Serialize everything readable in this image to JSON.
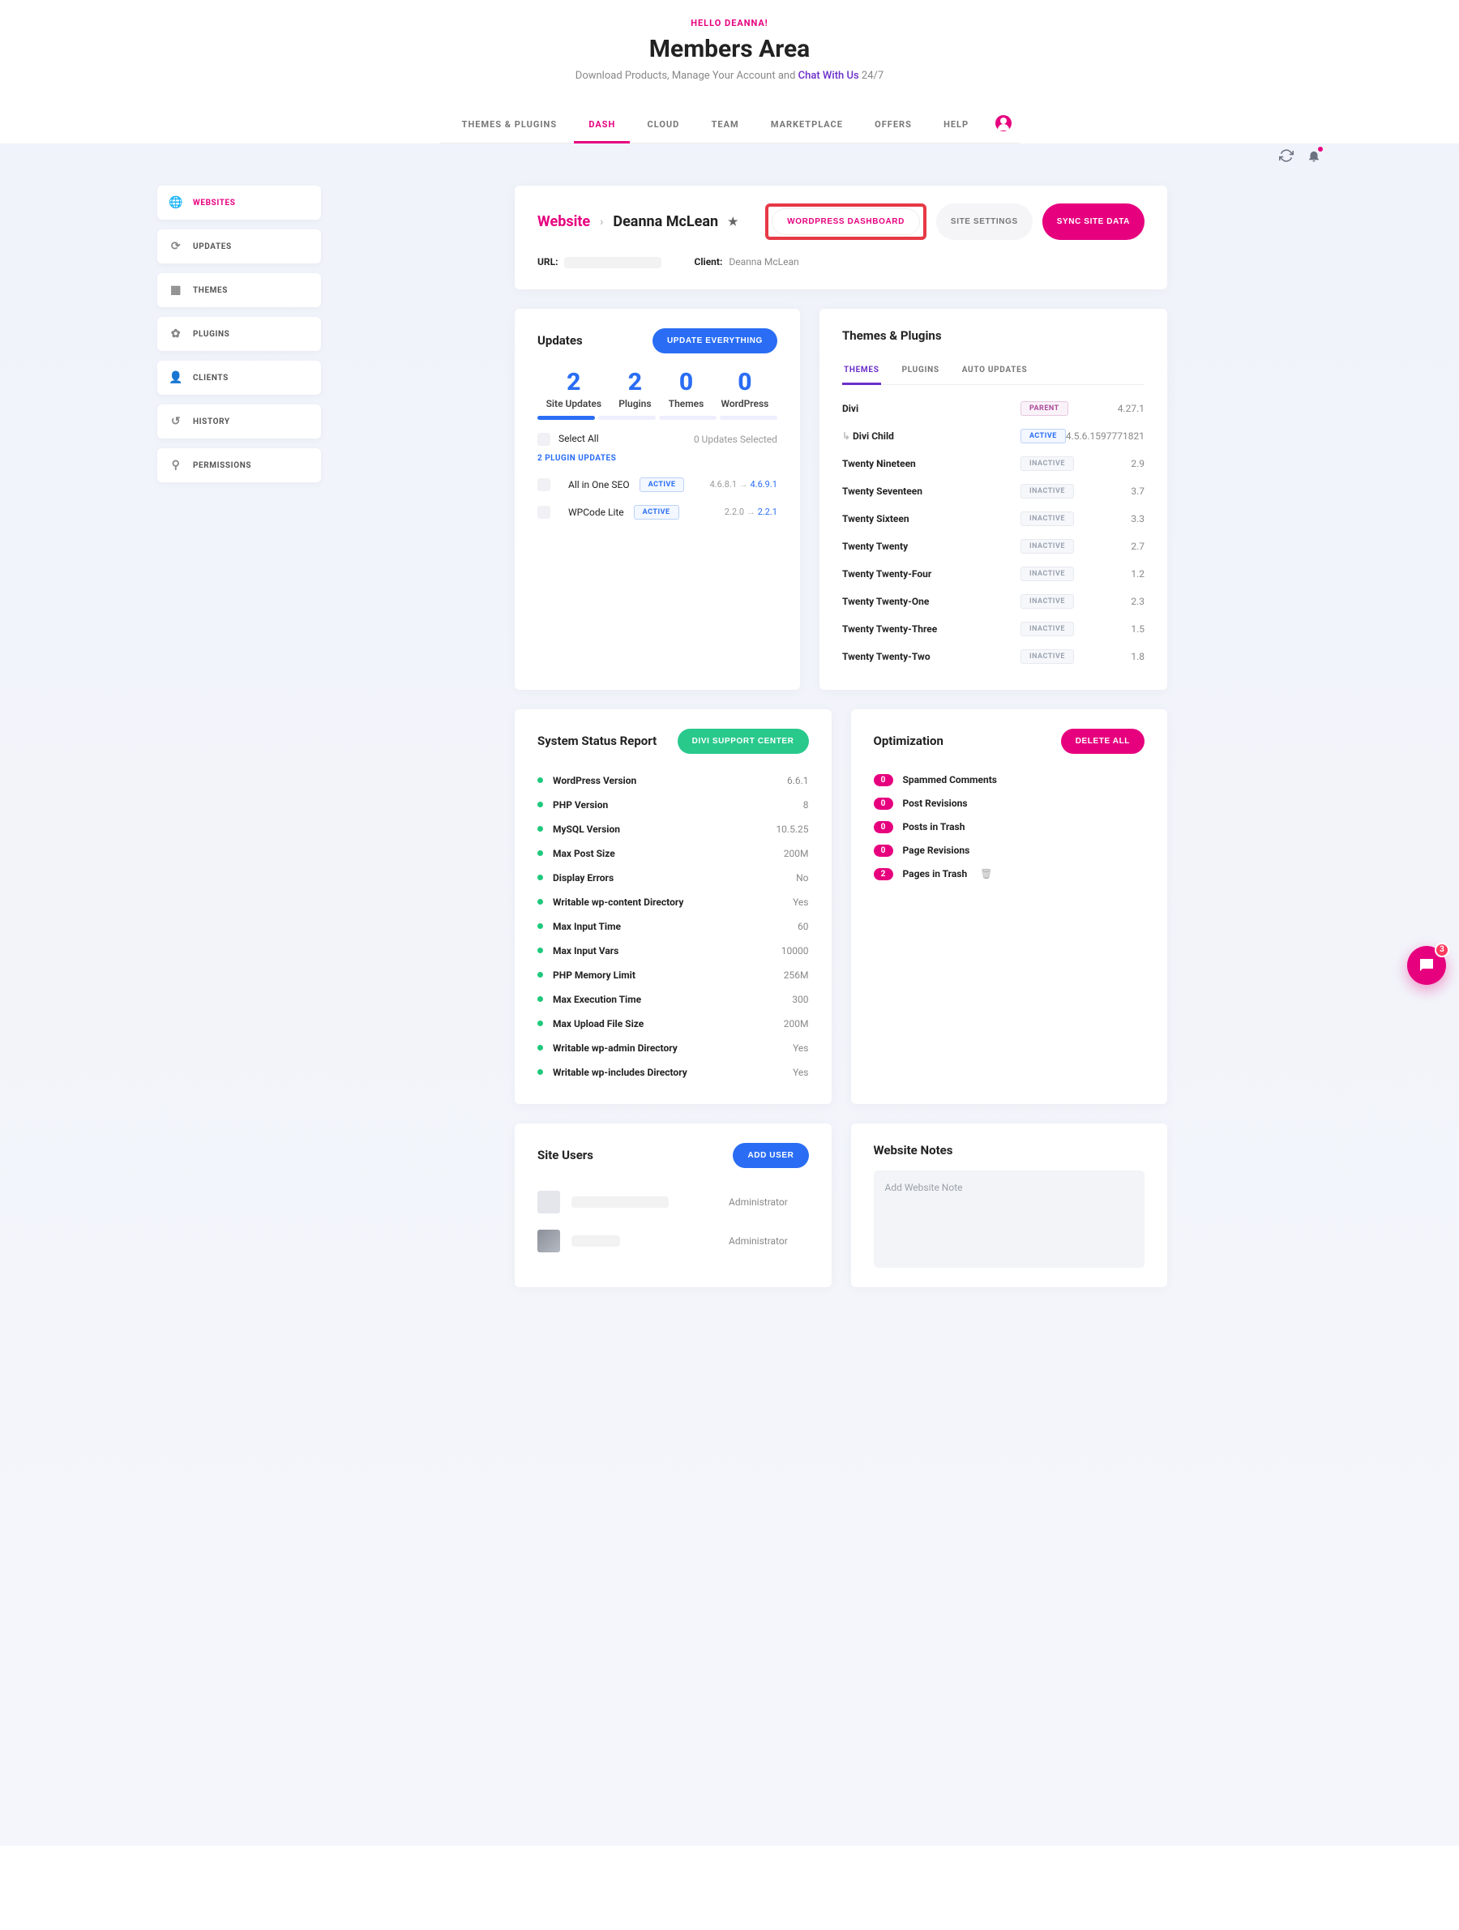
{
  "header": {
    "hello": "HELLO DEANNA!",
    "title": "Members Area",
    "subtitle_pre": "Download Products, Manage Your Account and ",
    "subtitle_link": "Chat With Us",
    "subtitle_post": " 24/7"
  },
  "nav": {
    "items": [
      "THEMES & PLUGINS",
      "DASH",
      "CLOUD",
      "TEAM",
      "MARKETPLACE",
      "OFFERS",
      "HELP"
    ],
    "active_index": 1
  },
  "sidebar": {
    "items": [
      {
        "icon": "globe",
        "label": "WEBSITES",
        "active": true
      },
      {
        "icon": "refresh",
        "label": "UPDATES"
      },
      {
        "icon": "palette",
        "label": "THEMES"
      },
      {
        "icon": "puzzle",
        "label": "PLUGINS"
      },
      {
        "icon": "person",
        "label": "CLIENTS"
      },
      {
        "icon": "clock",
        "label": "HISTORY"
      },
      {
        "icon": "key",
        "label": "PERMISSIONS"
      }
    ]
  },
  "breadcrumb": {
    "website": "Website",
    "name": "Deanna McLean",
    "wp_dashboard": "WORDPRESS DASHBOARD",
    "site_settings": "SITE SETTINGS",
    "sync": "SYNC SITE DATA",
    "url_label": "URL:",
    "client_label": "Client:",
    "client_value": "Deanna McLean"
  },
  "updates": {
    "title": "Updates",
    "btn": "UPDATE EVERYTHING",
    "stats": [
      {
        "num": "2",
        "label": "Site Updates"
      },
      {
        "num": "2",
        "label": "Plugins"
      },
      {
        "num": "0",
        "label": "Themes"
      },
      {
        "num": "0",
        "label": "WordPress"
      }
    ],
    "select_all": "Select All",
    "selected": "0 Updates Selected",
    "subhead": "2 PLUGIN UPDATES",
    "plugins": [
      {
        "name": "All in One SEO",
        "badge": "ACTIVE",
        "from": "4.6.8.1",
        "to": "4.6.9.1"
      },
      {
        "name": "WPCode Lite",
        "badge": "ACTIVE",
        "from": "2.2.0",
        "to": "2.2.1"
      }
    ]
  },
  "themes": {
    "title": "Themes & Plugins",
    "tabs": [
      "THEMES",
      "PLUGINS",
      "AUTO UPDATES"
    ],
    "active_tab": 0,
    "rows": [
      {
        "name": "Divi",
        "badge": "PARENT",
        "version": "4.27.1",
        "child": false
      },
      {
        "name": "Divi Child",
        "badge": "ACTIVE",
        "version": "4.5.6.1597771821",
        "child": true
      },
      {
        "name": "Twenty Nineteen",
        "badge": "INACTIVE",
        "version": "2.9"
      },
      {
        "name": "Twenty Seventeen",
        "badge": "INACTIVE",
        "version": "3.7"
      },
      {
        "name": "Twenty Sixteen",
        "badge": "INACTIVE",
        "version": "3.3"
      },
      {
        "name": "Twenty Twenty",
        "badge": "INACTIVE",
        "version": "2.7"
      },
      {
        "name": "Twenty Twenty-Four",
        "badge": "INACTIVE",
        "version": "1.2"
      },
      {
        "name": "Twenty Twenty-One",
        "badge": "INACTIVE",
        "version": "2.3"
      },
      {
        "name": "Twenty Twenty-Three",
        "badge": "INACTIVE",
        "version": "1.5"
      },
      {
        "name": "Twenty Twenty-Two",
        "badge": "INACTIVE",
        "version": "1.8"
      }
    ]
  },
  "status": {
    "title": "System Status Report",
    "btn": "DIVI SUPPORT CENTER",
    "rows": [
      {
        "name": "WordPress Version",
        "value": "6.6.1"
      },
      {
        "name": "PHP Version",
        "value": "8"
      },
      {
        "name": "MySQL Version",
        "value": "10.5.25"
      },
      {
        "name": "Max Post Size",
        "value": "200M"
      },
      {
        "name": "Display Errors",
        "value": "No"
      },
      {
        "name": "Writable wp-content Directory",
        "value": "Yes"
      },
      {
        "name": "Max Input Time",
        "value": "60"
      },
      {
        "name": "Max Input Vars",
        "value": "10000"
      },
      {
        "name": "PHP Memory Limit",
        "value": "256M"
      },
      {
        "name": "Max Execution Time",
        "value": "300"
      },
      {
        "name": "Max Upload File Size",
        "value": "200M"
      },
      {
        "name": "Writable wp-admin Directory",
        "value": "Yes"
      },
      {
        "name": "Writable wp-includes Directory",
        "value": "Yes"
      }
    ]
  },
  "optimization": {
    "title": "Optimization",
    "btn": "DELETE ALL",
    "rows": [
      {
        "count": "0",
        "label": "Spammed Comments"
      },
      {
        "count": "0",
        "label": "Post Revisions"
      },
      {
        "count": "0",
        "label": "Posts in Trash"
      },
      {
        "count": "0",
        "label": "Page Revisions"
      },
      {
        "count": "2",
        "label": "Pages in Trash",
        "trash": true
      }
    ]
  },
  "users": {
    "title": "Site Users",
    "btn": "ADD USER",
    "rows": [
      {
        "role": "Administrator"
      },
      {
        "role": "Administrator"
      }
    ]
  },
  "notes": {
    "title": "Website Notes",
    "placeholder": "Add Website Note"
  },
  "chat": {
    "badge": "3"
  }
}
